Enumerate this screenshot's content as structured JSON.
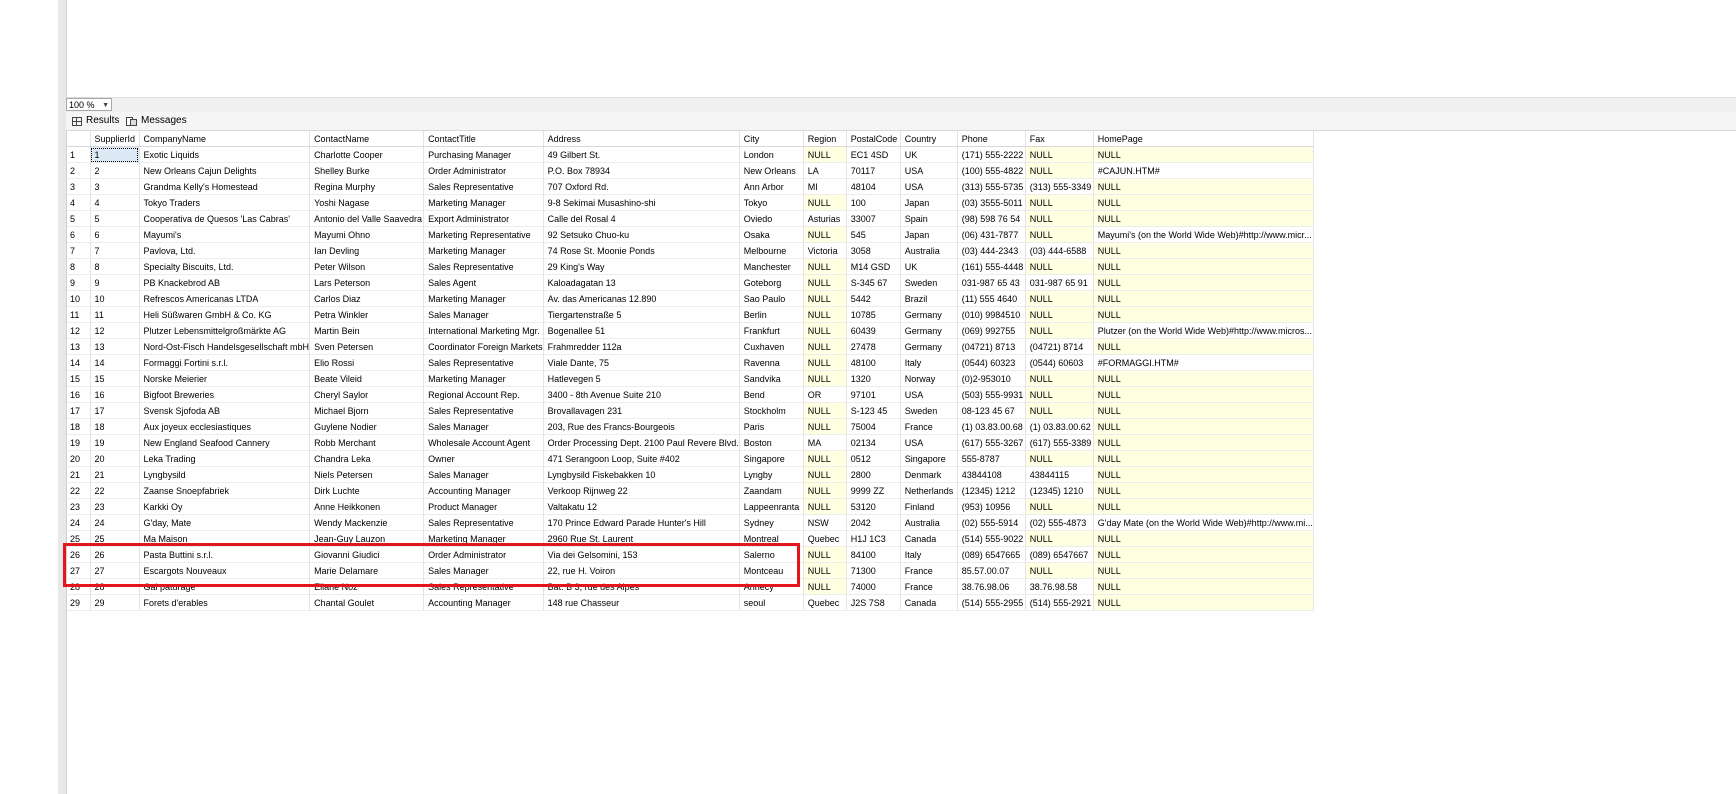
{
  "zoom": {
    "value": "100 %"
  },
  "tabs": [
    {
      "label": "Results",
      "icon": "grid-icon"
    },
    {
      "label": "Messages",
      "icon": "messages-icon"
    }
  ],
  "grid": {
    "columns": [
      "SupplierId",
      "CompanyName",
      "ContactName",
      "ContactTitle",
      "Address",
      "City",
      "Region",
      "PostalCode",
      "Country",
      "Phone",
      "Fax",
      "HomePage"
    ],
    "rows": [
      [
        "1",
        "Exotic Liquids",
        "Charlotte Cooper",
        "Purchasing Manager",
        "49 Gilbert St.",
        "London",
        "NULL",
        "EC1 4SD",
        "UK",
        "(171) 555-2222",
        "NULL",
        "NULL"
      ],
      [
        "2",
        "New Orleans Cajun Delights",
        "Shelley Burke",
        "Order Administrator",
        "P.O. Box 78934",
        "New Orleans",
        "LA",
        "70117",
        "USA",
        "(100) 555-4822",
        "NULL",
        "#CAJUN.HTM#"
      ],
      [
        "3",
        "Grandma Kelly's Homestead",
        "Regina Murphy",
        "Sales Representative",
        "707 Oxford Rd.",
        "Ann Arbor",
        "MI",
        "48104",
        "USA",
        "(313) 555-5735",
        "(313) 555-3349",
        "NULL"
      ],
      [
        "4",
        "Tokyo Traders",
        "Yoshi Nagase",
        "Marketing Manager",
        "9-8 Sekimai Musashino-shi",
        "Tokyo",
        "NULL",
        "100",
        "Japan",
        "(03) 3555-5011",
        "NULL",
        "NULL"
      ],
      [
        "5",
        "Cooperativa de Quesos 'Las Cabras'",
        "Antonio del Valle Saavedra",
        "Export Administrator",
        "Calle del Rosal 4",
        "Oviedo",
        "Asturias",
        "33007",
        "Spain",
        "(98) 598 76 54",
        "NULL",
        "NULL"
      ],
      [
        "6",
        "Mayumi's",
        "Mayumi Ohno",
        "Marketing Representative",
        "92 Setsuko Chuo-ku",
        "Osaka",
        "NULL",
        "545",
        "Japan",
        "(06) 431-7877",
        "NULL",
        "Mayumi's (on the World Wide Web)#http://www.micr..."
      ],
      [
        "7",
        "Pavlova, Ltd.",
        "Ian Devling",
        "Marketing Manager",
        "74 Rose St. Moonie Ponds",
        "Melbourne",
        "Victoria",
        "3058",
        "Australia",
        "(03) 444-2343",
        "(03) 444-6588",
        "NULL"
      ],
      [
        "8",
        "Specialty Biscuits, Ltd.",
        "Peter Wilson",
        "Sales Representative",
        "29 King's Way",
        "Manchester",
        "NULL",
        "M14 GSD",
        "UK",
        "(161) 555-4448",
        "NULL",
        "NULL"
      ],
      [
        "9",
        "PB Knackebrod AB",
        "Lars Peterson",
        "Sales Agent",
        "Kaloadagatan 13",
        "Goteborg",
        "NULL",
        "S-345 67",
        "Sweden",
        "031-987 65 43",
        "031-987 65 91",
        "NULL"
      ],
      [
        "10",
        "Refrescos Americanas LTDA",
        "Carlos Diaz",
        "Marketing Manager",
        "Av. das Americanas 12.890",
        "Sao Paulo",
        "NULL",
        "5442",
        "Brazil",
        "(11) 555 4640",
        "NULL",
        "NULL"
      ],
      [
        "11",
        "Heli Süßwaren GmbH & Co. KG",
        "Petra Winkler",
        "Sales Manager",
        "Tiergartenstraße 5",
        "Berlin",
        "NULL",
        "10785",
        "Germany",
        "(010) 9984510",
        "NULL",
        "NULL"
      ],
      [
        "12",
        "Plutzer Lebensmittelgroßmärkte AG",
        "Martin Bein",
        "International Marketing Mgr.",
        "Bogenallee 51",
        "Frankfurt",
        "NULL",
        "60439",
        "Germany",
        "(069) 992755",
        "NULL",
        "Plutzer (on the World Wide Web)#http://www.micros..."
      ],
      [
        "13",
        "Nord-Ost-Fisch Handelsgesellschaft mbH",
        "Sven Petersen",
        "Coordinator Foreign Markets",
        "Frahmredder 112a",
        "Cuxhaven",
        "NULL",
        "27478",
        "Germany",
        "(04721) 8713",
        "(04721) 8714",
        "NULL"
      ],
      [
        "14",
        "Formaggi Fortini s.r.l.",
        "Elio Rossi",
        "Sales Representative",
        "Viale Dante, 75",
        "Ravenna",
        "NULL",
        "48100",
        "Italy",
        "(0544) 60323",
        "(0544) 60603",
        "#FORMAGGI.HTM#"
      ],
      [
        "15",
        "Norske Meierier",
        "Beate Vileid",
        "Marketing Manager",
        "Hatlevegen 5",
        "Sandvika",
        "NULL",
        "1320",
        "Norway",
        "(0)2-953010",
        "NULL",
        "NULL"
      ],
      [
        "16",
        "Bigfoot Breweries",
        "Cheryl Saylor",
        "Regional Account Rep.",
        "3400 - 8th Avenue Suite 210",
        "Bend",
        "OR",
        "97101",
        "USA",
        "(503) 555-9931",
        "NULL",
        "NULL"
      ],
      [
        "17",
        "Svensk Sjofoda AB",
        "Michael Bjorn",
        "Sales Representative",
        "Brovallavagen 231",
        "Stockholm",
        "NULL",
        "S-123 45",
        "Sweden",
        "08-123 45 67",
        "NULL",
        "NULL"
      ],
      [
        "18",
        "Aux joyeux ecclesiastiques",
        "Guylene Nodier",
        "Sales Manager",
        "203, Rue des Francs-Bourgeois",
        "Paris",
        "NULL",
        "75004",
        "France",
        "(1) 03.83.00.68",
        "(1) 03.83.00.62",
        "NULL"
      ],
      [
        "19",
        "New England Seafood Cannery",
        "Robb Merchant",
        "Wholesale Account Agent",
        "Order Processing Dept. 2100 Paul Revere Blvd.",
        "Boston",
        "MA",
        "02134",
        "USA",
        "(617) 555-3267",
        "(617) 555-3389",
        "NULL"
      ],
      [
        "20",
        "Leka Trading",
        "Chandra Leka",
        "Owner",
        "471 Serangoon Loop, Suite #402",
        "Singapore",
        "NULL",
        "0512",
        "Singapore",
        "555-8787",
        "NULL",
        "NULL"
      ],
      [
        "21",
        "Lyngbysild",
        "Niels Petersen",
        "Sales Manager",
        "Lyngbysild Fiskebakken 10",
        "Lyngby",
        "NULL",
        "2800",
        "Denmark",
        "43844108",
        "43844115",
        "NULL"
      ],
      [
        "22",
        "Zaanse Snoepfabriek",
        "Dirk Luchte",
        "Accounting Manager",
        "Verkoop Rijnweg 22",
        "Zaandam",
        "NULL",
        "9999 ZZ",
        "Netherlands",
        "(12345) 1212",
        "(12345) 1210",
        "NULL"
      ],
      [
        "23",
        "Karkki Oy",
        "Anne Heikkonen",
        "Product Manager",
        "Valtakatu 12",
        "Lappeenranta",
        "NULL",
        "53120",
        "Finland",
        "(953) 10956",
        "NULL",
        "NULL"
      ],
      [
        "24",
        "G'day, Mate",
        "Wendy Mackenzie",
        "Sales Representative",
        "170 Prince Edward Parade Hunter's Hill",
        "Sydney",
        "NSW",
        "2042",
        "Australia",
        "(02) 555-5914",
        "(02) 555-4873",
        "G'day Mate (on the World Wide Web)#http://www.mi..."
      ],
      [
        "25",
        "Ma Maison",
        "Jean-Guy Lauzon",
        "Marketing Manager",
        "2960 Rue St. Laurent",
        "Montreal",
        "Quebec",
        "H1J 1C3",
        "Canada",
        "(514) 555-9022",
        "NULL",
        "NULL"
      ],
      [
        "26",
        "Pasta Buttini s.r.l.",
        "Giovanni Giudici",
        "Order Administrator",
        "Via dei Gelsomini, 153",
        "Salerno",
        "NULL",
        "84100",
        "Italy",
        "(089) 6547665",
        "(089) 6547667",
        "NULL"
      ],
      [
        "27",
        "Escargots Nouveaux",
        "Marie Delamare",
        "Sales Manager",
        "22, rue H. Voiron",
        "Montceau",
        "NULL",
        "71300",
        "France",
        "85.57.00.07",
        "NULL",
        "NULL"
      ],
      [
        "28",
        "Gai paturage",
        "Eliane Noz",
        "Sales Representative",
        "Bat. B 3, rue des Alpes",
        "Annecy",
        "NULL",
        "74000",
        "France",
        "38.76.98.06",
        "38.76.98.58",
        "NULL"
      ],
      [
        "29",
        "Forets d'erables",
        "Chantal Goulet",
        "Accounting Manager",
        "148 rue Chasseur",
        "seoul",
        "Quebec",
        "J2S 7S8",
        "Canada",
        "(514) 555-2955",
        "(514) 555-2921",
        "NULL"
      ]
    ]
  },
  "colors": {
    "null_bg": "#ffffe1",
    "highlight": "#e2171b"
  }
}
